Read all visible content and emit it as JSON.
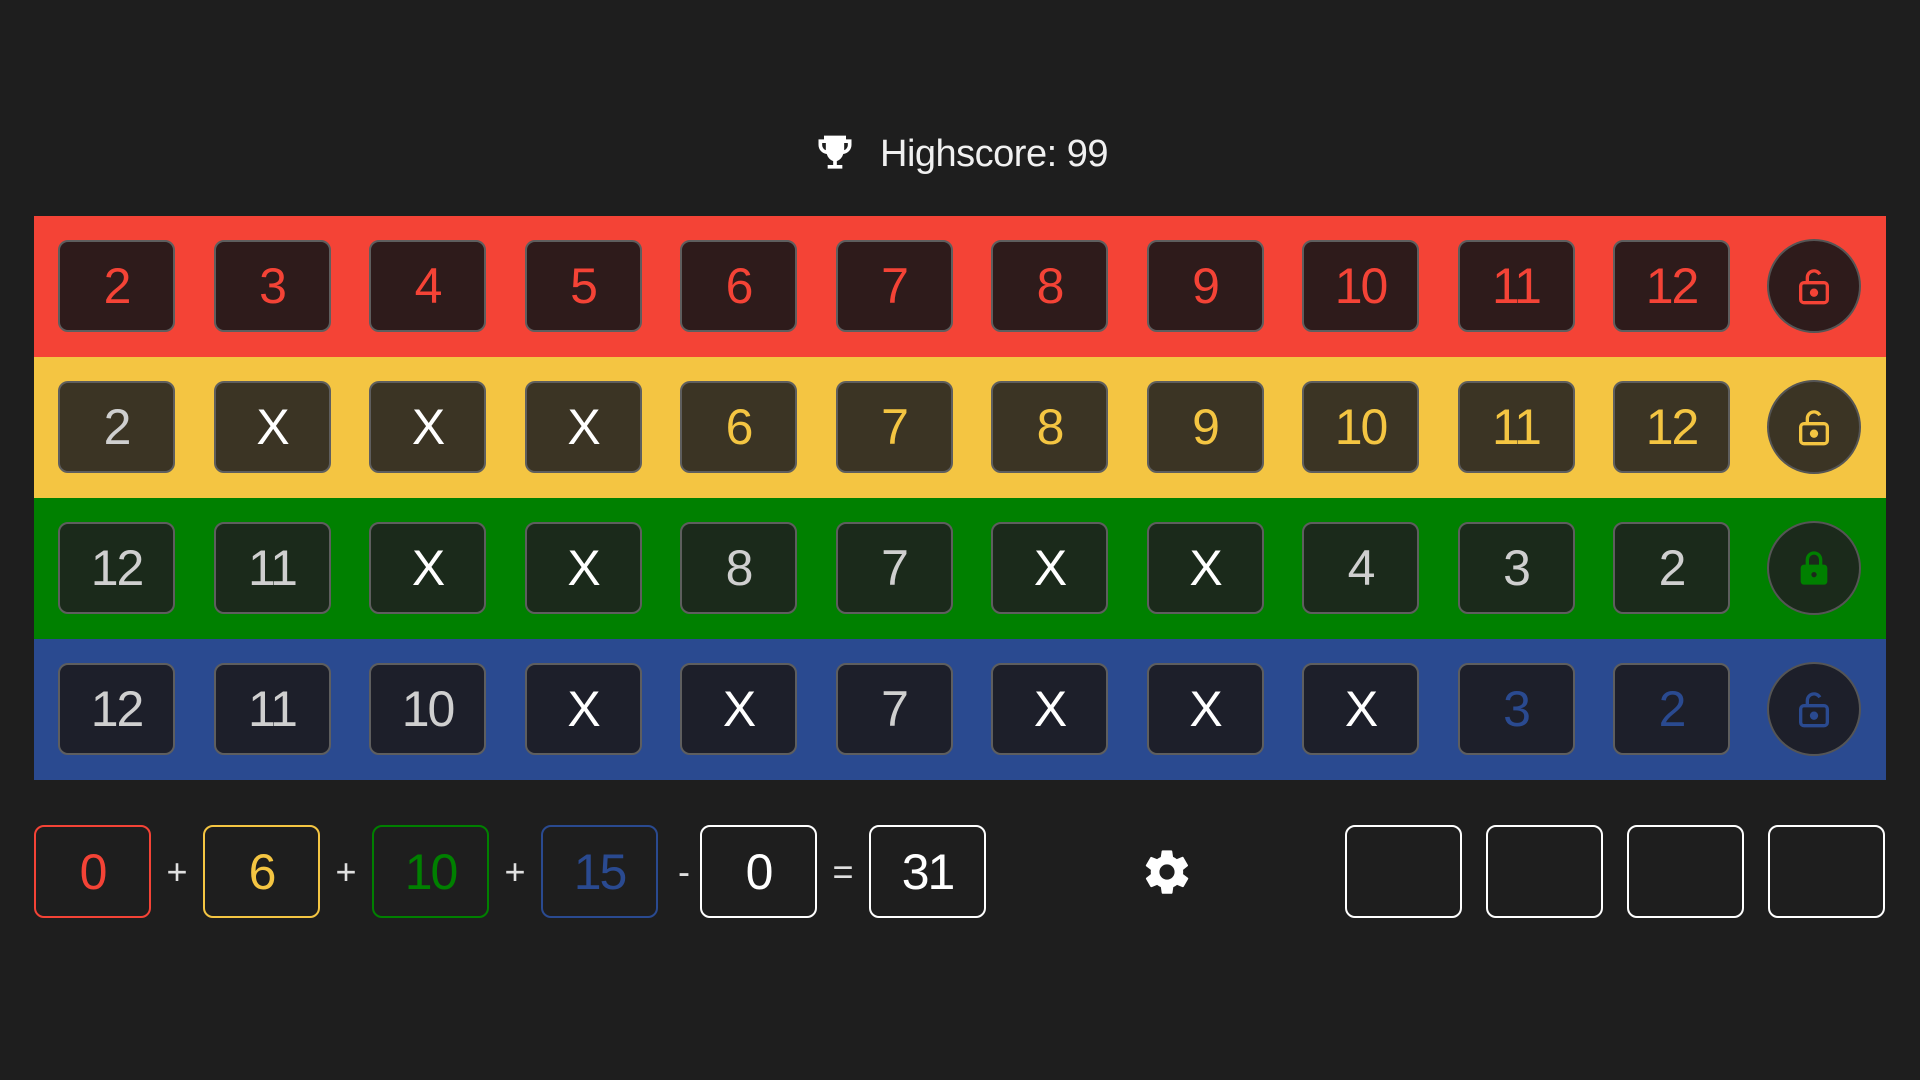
{
  "header": {
    "highscore_label": "Highscore: 99",
    "icon": "trophy-icon"
  },
  "colors": {
    "red": "#f44336",
    "yellow": "#f4c542",
    "green": "#008000",
    "blue": "#2a4a90",
    "background": "#1e1e1e"
  },
  "rows": [
    {
      "color": "red",
      "bg": "#f44336",
      "cellBg": "#2e1b1b",
      "numColor": "#f44336",
      "xColor": "#ffffff",
      "lockBg": "#2e1b1b",
      "lockIcon": "#f44336",
      "lockState": "unlocked",
      "cells": [
        "2",
        "3",
        "4",
        "5",
        "6",
        "7",
        "8",
        "9",
        "10",
        "11",
        "12"
      ],
      "dimmed": []
    },
    {
      "color": "yellow",
      "bg": "#f4c542",
      "cellBg": "#3b3424",
      "numColor": "#f4c542",
      "xColor": "#ffffff",
      "lockBg": "#3b3424",
      "lockIcon": "#f4c542",
      "lockState": "unlocked",
      "cells": [
        "2",
        "X",
        "X",
        "X",
        "6",
        "7",
        "8",
        "9",
        "10",
        "11",
        "12"
      ],
      "dimmed": [
        0
      ]
    },
    {
      "color": "green",
      "bg": "#008000",
      "cellBg": "#1b2a1b",
      "numColor": "#cfcfcf",
      "xColor": "#ffffff",
      "lockBg": "#1b2a1b",
      "lockIcon": "#008000",
      "lockState": "locked",
      "cells": [
        "12",
        "11",
        "X",
        "X",
        "8",
        "7",
        "X",
        "X",
        "4",
        "3",
        "2"
      ],
      "dimmed": []
    },
    {
      "color": "blue",
      "bg": "#2a4a90",
      "cellBg": "#1d1f2a",
      "numColor": "#cfcfcf",
      "xColor": "#ffffff",
      "lockBg": "#1d1f2a",
      "lockIcon": "#2a4a90",
      "lockState": "unlocked",
      "cells": [
        "12",
        "11",
        "10",
        "X",
        "X",
        "7",
        "X",
        "X",
        "X",
        "3",
        "2"
      ],
      "highlight": [
        9,
        10
      ],
      "highlightColor": "#2a4a90"
    }
  ],
  "score": {
    "red": "0",
    "yellow": "6",
    "green": "10",
    "blue": "15",
    "penalty": "0",
    "total": "31",
    "ops": [
      "+",
      "+",
      "+",
      "-",
      "="
    ]
  },
  "settings": {
    "icon": "gear-icon"
  },
  "penalties": [
    "",
    "",
    "",
    ""
  ]
}
